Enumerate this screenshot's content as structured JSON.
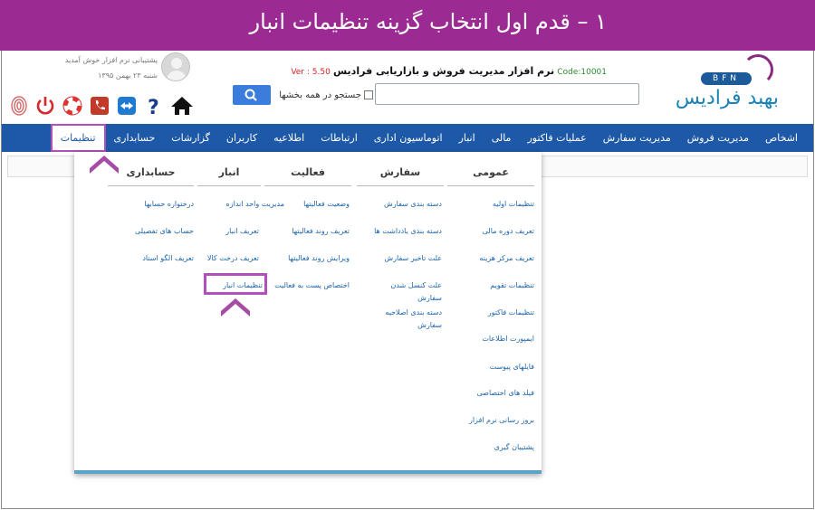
{
  "banner": {
    "title": "۱ – قدم اول انتخاب گزینه تنظیمات انبار"
  },
  "header": {
    "code": "Code:10001",
    "app_title": "نرم افزار مدیریت فروش و بازاریابی فرادیس",
    "version": "Ver : 5.50",
    "search_all_label": "جستجو در همه بخشها",
    "search_value": "",
    "user_greeting": "پشتیبانی نرم افزار خوش آمدید",
    "user_date": "شنبه ۲۳ بهمن ۱۳۹۵",
    "logo_badge": "BFN",
    "logo_text": "بهبد فرادیس"
  },
  "icons": [
    "fingerprint-icon",
    "power-icon",
    "lifebuoy-icon",
    "phone-icon",
    "teamviewer-icon",
    "help-icon",
    "home-icon"
  ],
  "nav": {
    "items": [
      "اشخاص",
      "مدیریت فروش",
      "مدیریت سفارش",
      "عملیات فاکتور",
      "مالی",
      "انبار",
      "اتوماسیون اداری",
      "ارتباطات",
      "اطلاعیه",
      "کاربران",
      "گزارشات",
      "حسابداری",
      "تنظیمات"
    ]
  },
  "menu": {
    "columns": [
      {
        "title": "عمومی",
        "items": [
          "تنظیمات اولیه",
          "تعریف دوره مالی",
          "تعریف مرکز هزینه",
          "تنظیمات تقویم",
          "تنظیمات فاکتور",
          "ایمپورت اطلاعات",
          "فایلهای پیوست",
          "فیلد های اختصاصی",
          "بروز رسانی نرم افزار",
          "پشتیبان گیری"
        ]
      },
      {
        "title": "سفارش",
        "items": [
          "دسته بندی سفارش",
          "دسته بندی یادداشت ها",
          "علت تاخیر سفارش",
          "علت کنسل شدن سفارش",
          "دسته بندی اصلاحیه سفارش"
        ]
      },
      {
        "title": "فعالیت",
        "items": [
          "وضعیت فعالیتها",
          "تعریف روند فعالیتها",
          "ویرایش روند فعالیتها",
          "اختصاص پست به فعالیت"
        ]
      },
      {
        "title": "انبار",
        "items": [
          "مدیریت واحد اندازه",
          "تعریف انبار",
          "تعریف درخت کالا",
          "تنظیمات انبار"
        ]
      },
      {
        "title": "حسابداری",
        "items": [
          "درختواره حسابها",
          "حساب های تفصیلی",
          "تعریف الگو اسناد"
        ]
      }
    ]
  },
  "colors": {
    "banner": "#9b2b93",
    "nav": "#1e59a8",
    "highlight": "#b14fbd",
    "link": "#1c64ad"
  }
}
